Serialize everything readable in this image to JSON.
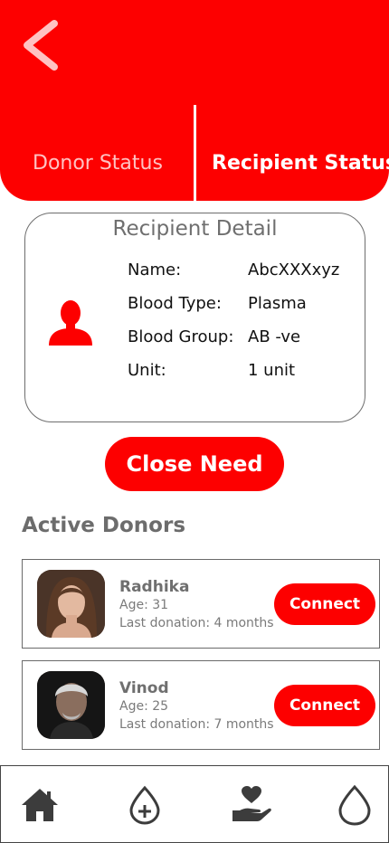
{
  "colors": {
    "accent": "#fd0000",
    "muted_text": "#6f6f6f"
  },
  "header": {
    "back_icon": "chevron-left-icon",
    "tabs": [
      {
        "label": "Donor Status",
        "active": false
      },
      {
        "label": "Recipient Status",
        "active": true
      }
    ]
  },
  "recipient_detail": {
    "title": "Recipient Detail",
    "icon": "person-icon",
    "fields": [
      {
        "label": "Name:",
        "value": "AbcXXXxyz"
      },
      {
        "label": "Blood Type:",
        "value": "Plasma"
      },
      {
        "label": "Blood Group:",
        "value": "AB -ve"
      },
      {
        "label": "Unit:",
        "value": "1 unit"
      }
    ]
  },
  "close_need_label": "Close Need",
  "active_donors": {
    "title": "Active Donors",
    "donors": [
      {
        "name": "Radhika",
        "age": "Age: 31",
        "last_donation": "Last donation: 4 months",
        "connect_label": "Connect"
      },
      {
        "name": "Vinod",
        "age": "Age: 25",
        "last_donation": "Last donation: 7 months",
        "connect_label": "Connect"
      }
    ]
  },
  "bottom_nav": {
    "items": [
      {
        "icon": "home-icon"
      },
      {
        "icon": "add-blood-drop-icon"
      },
      {
        "icon": "hand-heart-icon"
      },
      {
        "icon": "blood-drop-icon"
      }
    ]
  }
}
